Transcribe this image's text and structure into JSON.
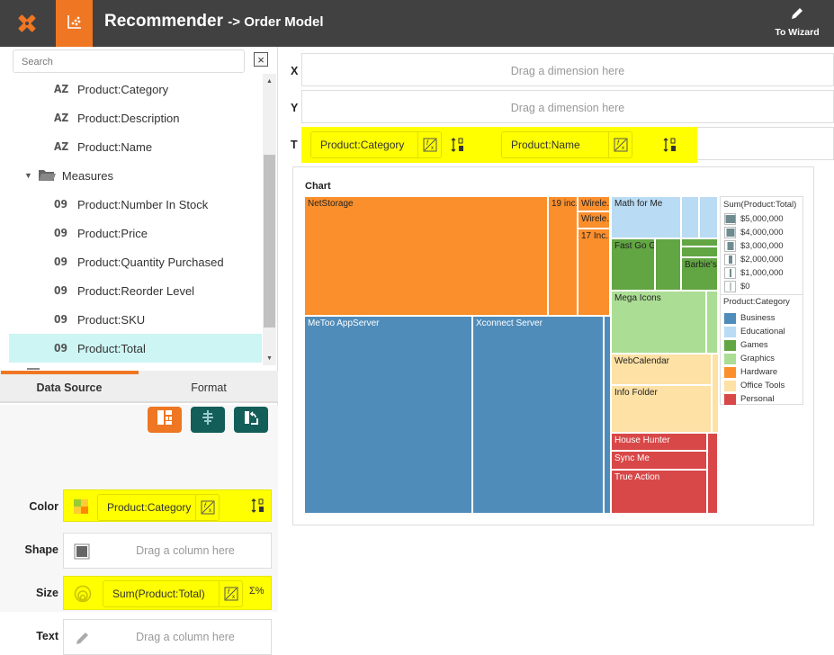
{
  "header": {
    "app_title": "Recommender",
    "subtitle": "-> Order Model",
    "wizard_label": "To Wizard",
    "colors": {
      "bar": "#414141",
      "accent": "#ef7622"
    }
  },
  "sidebar": {
    "search_placeholder": "Search",
    "tree": [
      {
        "type_icon": "AZ",
        "label": "Product:Category"
      },
      {
        "type_icon": "AZ",
        "label": "Product:Description"
      },
      {
        "type_icon": "AZ",
        "label": "Product:Name"
      }
    ],
    "folder": {
      "label": "Measures",
      "expanded": true
    },
    "measures": [
      {
        "type_icon": "09",
        "label": "Product:Number In Stock"
      },
      {
        "type_icon": "09",
        "label": "Product:Price"
      },
      {
        "type_icon": "09",
        "label": "Product:Quantity Purchased"
      },
      {
        "type_icon": "09",
        "label": "Product:Reorder Level"
      },
      {
        "type_icon": "09",
        "label": "Product:SKU"
      },
      {
        "type_icon": "09",
        "label": "Product:Total",
        "selected": true
      }
    ],
    "tabs": [
      {
        "label": "Data Source",
        "active": true
      },
      {
        "label": "Format",
        "active": false
      }
    ],
    "bindings": {
      "color": {
        "label": "Color",
        "value": "Product:Category"
      },
      "shape": {
        "label": "Shape",
        "placeholder": "Drag a column here"
      },
      "size": {
        "label": "Size",
        "value": "Sum(Product:Total)"
      },
      "text": {
        "label": "Text",
        "placeholder": "Drag a column here"
      }
    }
  },
  "main": {
    "x": {
      "label": "X",
      "placeholder": "Drag a dimension here"
    },
    "y": {
      "label": "Y",
      "placeholder": "Drag a dimension here"
    },
    "t": {
      "label": "T",
      "fields": [
        "Product:Category",
        "Product:Name"
      ]
    }
  },
  "chart_data": {
    "type": "treemap",
    "title": "Chart",
    "size_measure": "Sum(Product:Total)",
    "color_dimension": "Product:Category",
    "categories": [
      {
        "name": "Business",
        "color": "#4f8cba"
      },
      {
        "name": "Educational",
        "color": "#b9dbf3"
      },
      {
        "name": "Games",
        "color": "#62a543"
      },
      {
        "name": "Graphics",
        "color": "#abdd94"
      },
      {
        "name": "Hardware",
        "color": "#fb8f2c"
      },
      {
        "name": "Office Tools",
        "color": "#fde1a5"
      },
      {
        "name": "Personal",
        "color": "#d84848"
      }
    ],
    "labeled_cells": [
      {
        "category": "Hardware",
        "label": "NetStorage"
      },
      {
        "category": "Hardware",
        "label": "19 inc.."
      },
      {
        "category": "Hardware",
        "label": "Wirele.."
      },
      {
        "category": "Hardware",
        "label": "Wirele.."
      },
      {
        "category": "Hardware",
        "label": "17 Inc.."
      },
      {
        "category": "Business",
        "label": "MeToo AppServer"
      },
      {
        "category": "Business",
        "label": "Xconnect Server"
      },
      {
        "category": "Educational",
        "label": "Math for Me"
      },
      {
        "category": "Games",
        "label": "Fast Go G.."
      },
      {
        "category": "Games",
        "label": "Barbie's.."
      },
      {
        "category": "Graphics",
        "label": "Mega Icons"
      },
      {
        "category": "Office Tools",
        "label": "WebCalendar"
      },
      {
        "category": "Office Tools",
        "label": "Info Folder"
      },
      {
        "category": "Personal",
        "label": "House Hunter"
      },
      {
        "category": "Personal",
        "label": "Sync Me"
      },
      {
        "category": "Personal",
        "label": "True Action"
      }
    ],
    "size_legend": {
      "title": "Sum(Product:Total)",
      "values": [
        "$5,000,000",
        "$4,000,000",
        "$3,000,000",
        "$2,000,000",
        "$1,000,000",
        "$0"
      ]
    },
    "color_legend": {
      "title": "Product:Category"
    }
  }
}
